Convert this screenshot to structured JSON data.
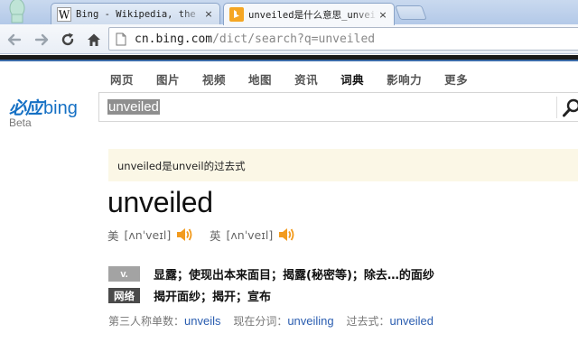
{
  "browser": {
    "tabs": [
      {
        "title": "Bing - Wikipedia, the free encyclopedia",
        "favicon": "wikipedia-icon",
        "close": "×"
      },
      {
        "title": "unveiled是什么意思_unveiled的中文",
        "favicon": "bing-icon",
        "close": "×"
      }
    ],
    "url_host": "cn.bing.com",
    "url_path": "/dict/search?q=unveiled"
  },
  "bing": {
    "nav": [
      "网页",
      "图片",
      "视频",
      "地图",
      "资讯",
      "词典",
      "影响力",
      "更多"
    ],
    "nav_active_index": 5,
    "logo_cn": "必应",
    "logo_en": "bing",
    "logo_beta": "Beta",
    "query": "unveiled",
    "colors": {
      "logo": "#1570c4",
      "link": "#2a5db0",
      "notice_bg": "#fbf7e6"
    }
  },
  "dict": {
    "notice": "unveiled是unveil的过去式",
    "headword": "unveiled",
    "pron_us_label": "美",
    "pron_us": "[ʌnˈveɪl]",
    "pron_uk_label": "英",
    "pron_uk": "[ʌnˈveɪl]",
    "definitions": [
      {
        "pos": "v.",
        "text": "显露；使现出本来面目；揭露(秘密等)；除去…的面纱"
      },
      {
        "pos": "网络",
        "text": "揭开面纱；揭开；宣布"
      }
    ],
    "forms": {
      "third_label": "第三人称单数：",
      "third": "unveils",
      "pres_label": "现在分词：",
      "pres": "unveiling",
      "past_label": "过去式：",
      "past": "unveiled"
    }
  }
}
